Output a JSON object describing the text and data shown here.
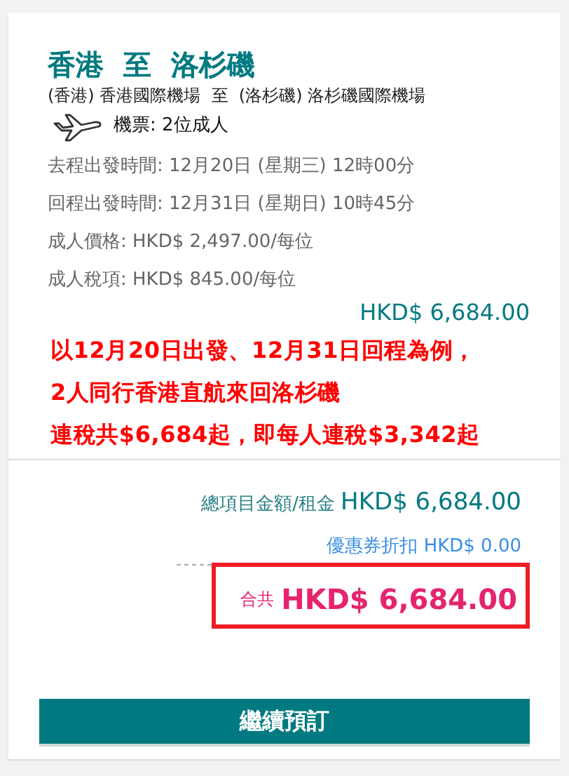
{
  "route": {
    "title": "香港  至  洛杉磯",
    "airports": "(香港) 香港國際機場  至  (洛杉磯) 洛杉磯國際機場",
    "tickets": "機票: 2位成人"
  },
  "details": [
    "去程出發時間: 12月20日 (星期三) 12時00分",
    "回程出發時間: 12月31日 (星期日) 10時45分",
    "成人價格: HKD$ 2,497.00/每位",
    "成人稅項: HKD$ 845.00/每位"
  ],
  "subtotal": "HKD$ 6,684.00",
  "annotation": [
    "以12月20日出發、12月31日回程為例，",
    "2人同行香港直航來回洛杉磯",
    "連稅共$6,684起，即每人連稅$3,342起"
  ],
  "summary": {
    "fare_label": "總項目金額/租金",
    "fare_amount": "HKD$ 6,684.00",
    "coupon": "優惠券折扣 HKD$ 0.00",
    "total_label": "合共",
    "total_amount": "HKD$ 6,684.00"
  },
  "continue_button": "繼續預訂"
}
